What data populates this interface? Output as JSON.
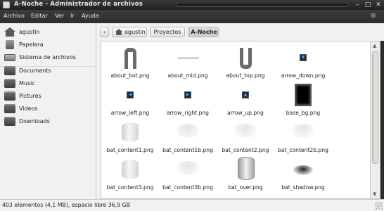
{
  "window": {
    "title": "A-Noche - Administrador de archivos"
  },
  "menubar": {
    "items": [
      "Archivo",
      "Editar",
      "Ver",
      "Ir",
      "Ayuda"
    ]
  },
  "sidebar": {
    "places": [
      {
        "label": "agustin",
        "icon": "home-icon"
      },
      {
        "label": "Papelera",
        "icon": "trash-icon"
      },
      {
        "label": "Sistema de archivos",
        "icon": "drive-icon"
      }
    ],
    "bookmarks": [
      {
        "label": "Documents",
        "icon": "folder-icon"
      },
      {
        "label": "Music",
        "icon": "folder-icon"
      },
      {
        "label": "Pictures",
        "icon": "folder-icon"
      },
      {
        "label": "Videos",
        "icon": "folder-icon"
      },
      {
        "label": "Downloads",
        "icon": "folder-icon"
      }
    ]
  },
  "pathbar": {
    "back_icon": "chevron-left-icon",
    "forward_icon": "chevron-right-icon",
    "crumbs": [
      "agustin",
      "Proyectos",
      "A-Noche"
    ],
    "active": "A-Noche"
  },
  "files": [
    {
      "name": "about_bot.png",
      "thumb": "arch"
    },
    {
      "name": "about_mid.png",
      "thumb": "line"
    },
    {
      "name": "about_top.png",
      "thumb": "u-shape"
    },
    {
      "name": "arrow_down.png",
      "thumb": "arrow-down"
    },
    {
      "name": "arrow_left.png",
      "thumb": "arrow-left"
    },
    {
      "name": "arrow_right.png",
      "thumb": "arrow-right"
    },
    {
      "name": "arrow_up.png",
      "thumb": "arrow-up"
    },
    {
      "name": "base_bg.png",
      "thumb": "black-panel"
    },
    {
      "name": "bat_content1.png",
      "thumb": "cylinder"
    },
    {
      "name": "bat_content1b.png",
      "thumb": "faint"
    },
    {
      "name": "bat_content2.png",
      "thumb": "faint"
    },
    {
      "name": "bat_content2b.png",
      "thumb": "faint"
    },
    {
      "name": "bat_content3.png",
      "thumb": "cylinder"
    },
    {
      "name": "bat_content3b.png",
      "thumb": "faint"
    },
    {
      "name": "bat_over.png",
      "thumb": "cylinder-outline"
    },
    {
      "name": "bat_shadow.png",
      "thumb": "shadow"
    }
  ],
  "statusbar": {
    "text": "403 elementos (4,1 MB), espacio libre 36,9 GB"
  },
  "colors": {
    "titlebar": "#2b2b2b",
    "sidebar": "#f2f1ef",
    "content": "#ffffff",
    "arrow_accent": "#3fa7ff"
  }
}
